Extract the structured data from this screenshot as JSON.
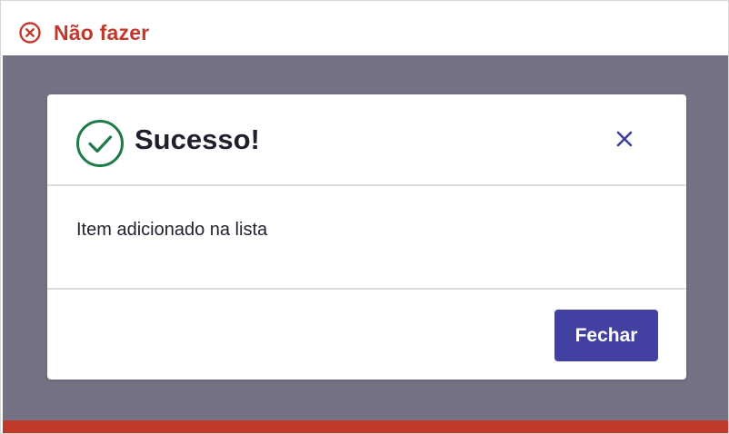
{
  "guideline": {
    "label": "Não fazer",
    "icon": "circle-x-icon",
    "color": "#c0392b"
  },
  "modal": {
    "icon": "check-circle-icon",
    "icon_color": "#1e7a46",
    "title": "Sucesso!",
    "close_icon": "close-icon",
    "close_icon_color": "#3f3d99",
    "message": "Item adicionado na lista",
    "primary_button": {
      "label": "Fechar",
      "color": "#4240a0"
    }
  },
  "backdrop_color": "#727284"
}
